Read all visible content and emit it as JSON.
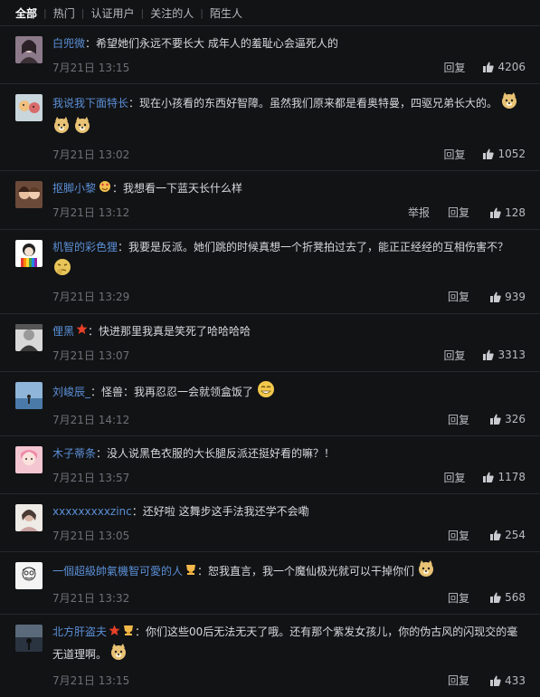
{
  "tabs": [
    "全部",
    "热门",
    "认证用户",
    "关注的人",
    "陌生人"
  ],
  "actions": {
    "reply": "回复",
    "report": "举报"
  },
  "colors": {
    "username": "#5b8fd6",
    "background": "#121315",
    "time": "#6d7076"
  },
  "comments": [
    {
      "user": "白兜微",
      "text": "希望她们永远不要长大 成年人的羞耻心会逼死人的",
      "time": "7月21日 13:15",
      "likes": "4206",
      "avatar": "avatar-girl",
      "badges": [],
      "report": false
    },
    {
      "user": "我说我下面特长",
      "text": "现在小孩看的东西好智障。虽然我们原来都是看奥特曼，四驱兄弟长大的。",
      "time": "7月21日 13:02",
      "likes": "1052",
      "avatar": "avatar-pets",
      "badges": [],
      "report": false
    },
    {
      "user": "抠脚小黎",
      "text": "我想看一下蓝天长什么样",
      "time": "7月21日 13:12",
      "likes": "128",
      "avatar": "avatar-couple",
      "badges": [
        "love-face-badge"
      ],
      "report": true
    },
    {
      "user": "机智的彩色狸",
      "text": "我要是反派。她们跳的时候真想一个折凳拍过去了，能正正经经的互相伤害不？",
      "time": "7月21日 13:29",
      "likes": "939",
      "avatar": "avatar-rainbow",
      "badges": [],
      "report": false
    },
    {
      "user": "俚黑",
      "text": "快进那里我真是笑死了哈哈哈哈",
      "time": "7月21日 13:07",
      "likes": "3313",
      "avatar": "avatar-bw",
      "badges": [
        "star-badge"
      ],
      "report": false
    },
    {
      "user": "刘峻辰_",
      "text": "怪兽：我再忍忍一会就领盒饭了",
      "time": "7月21日 14:12",
      "likes": "326",
      "avatar": "avatar-sea",
      "badges": [],
      "report": false
    },
    {
      "user": "木子蒂条",
      "text": "没人说黑色衣服的大长腿反派还挺好看的嘛？！",
      "time": "7月21日 13:57",
      "likes": "1178",
      "avatar": "avatar-pink",
      "badges": [],
      "report": false
    },
    {
      "user": "xxxxxxxxxzinc",
      "text": "还好啦 这舞步这手法我还学不会嘞",
      "time": "7月21日 13:05",
      "likes": "254",
      "avatar": "avatar-light",
      "badges": [],
      "report": false
    },
    {
      "user": "一個超級帥氣機智可愛的人",
      "text": "恕我直言，我一个魔仙极光就可以干掉你们",
      "time": "7月21日 13:32",
      "likes": "568",
      "avatar": "avatar-cartoon",
      "badges": [
        "cup-badge"
      ],
      "report": false
    },
    {
      "user": "北方肝盗夫",
      "text": "你们这些00后无法无天了哦。还有那个紫发女孩儿，你的伪古风的闪现交的毫无道理啊。",
      "time": "7月21日 13:15",
      "likes": "433",
      "avatar": "avatar-dark",
      "badges": [
        "star-badge",
        "cup-badge"
      ],
      "report": false
    }
  ]
}
